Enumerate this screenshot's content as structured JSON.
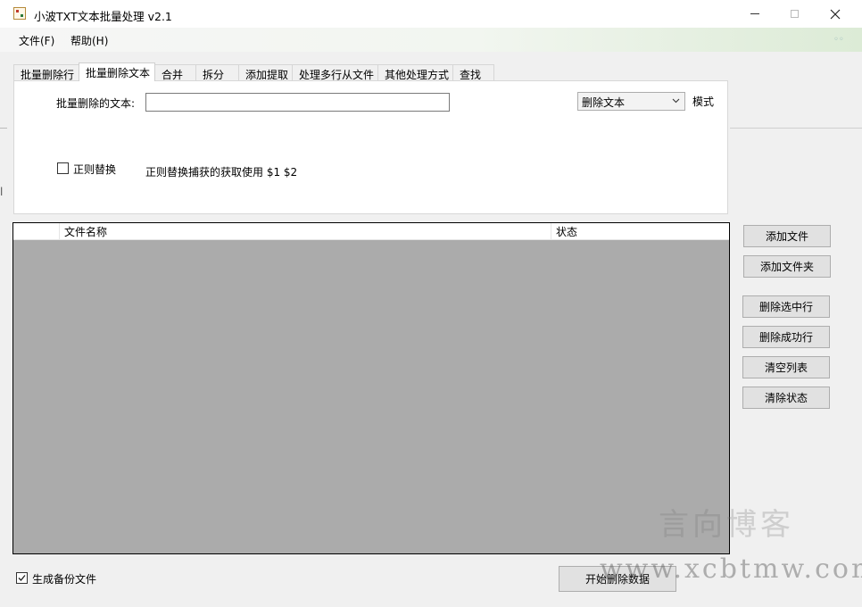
{
  "window": {
    "title": "小波TXT文本批量处理 v2.1"
  },
  "menu": {
    "items": [
      {
        "label": "文件(F)"
      },
      {
        "label": "帮助(H)"
      }
    ]
  },
  "tabs": [
    {
      "label": "批量删除行",
      "active": false
    },
    {
      "label": "批量删除文本",
      "active": true
    },
    {
      "label": "合并",
      "active": false
    },
    {
      "label": "拆分",
      "active": false
    },
    {
      "label": "添加提取",
      "active": false
    },
    {
      "label": "处理多行从文件",
      "active": false
    },
    {
      "label": "其他处理方式",
      "active": false
    },
    {
      "label": "查找",
      "active": false
    }
  ],
  "panel": {
    "delete_text_label": "批量删除的文本:",
    "delete_text_value": "",
    "mode_selected": "删除文本",
    "mode_label": "模式",
    "regex_label": "正则替换",
    "regex_checked": false,
    "regex_hint": "正则替换捕获的获取使用 $1 $2"
  },
  "file_list": {
    "columns": [
      "",
      "文件名称",
      "状态"
    ],
    "rows": []
  },
  "side_buttons": {
    "add_file": "添加文件",
    "add_folder": "添加文件夹",
    "delete_selected": "删除选中行",
    "delete_success": "删除成功行",
    "clear_list": "清空列表",
    "clear_status": "清除状态"
  },
  "bottom": {
    "backup_label": "生成备份文件",
    "backup_checked": true,
    "start_button": "开始删除数据"
  },
  "watermark": {
    "cn": "言向博客",
    "url": "www.xcbtmw.com"
  },
  "colors": {
    "list_background": "#ababab",
    "button_face": "#e1e1e1",
    "window_background": "#f0f0f0"
  }
}
